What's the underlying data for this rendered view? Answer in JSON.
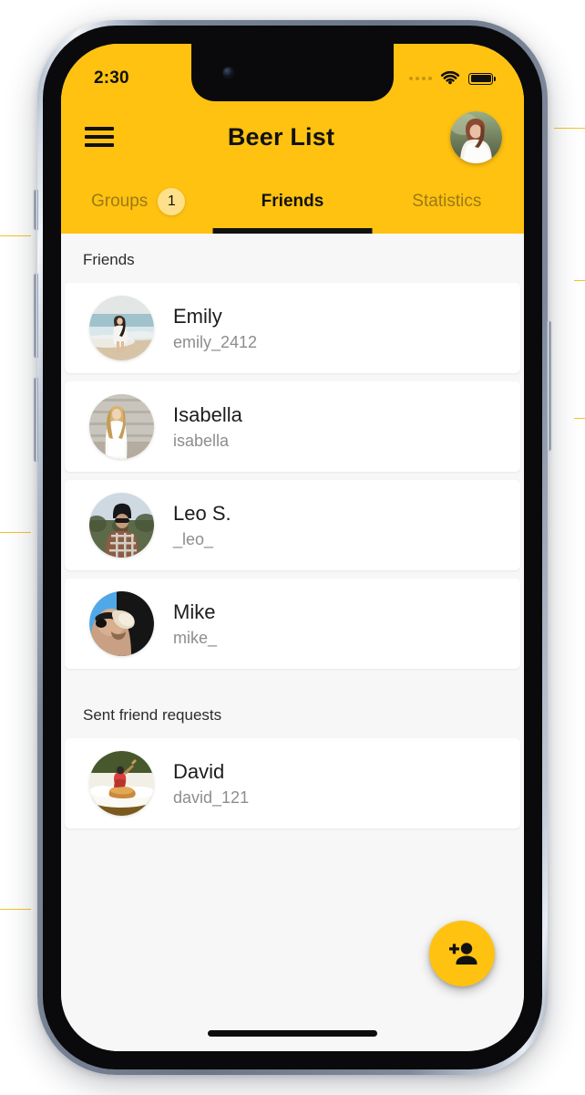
{
  "status_bar": {
    "time": "2:30",
    "signal_icon": "signal-dots-icon",
    "wifi_icon": "wifi-icon",
    "battery_icon": "battery-full-icon"
  },
  "app_bar": {
    "menu_icon": "hamburger-menu-icon",
    "title": "Beer List",
    "avatar_icon": "profile-avatar"
  },
  "tabs": [
    {
      "label": "Groups",
      "active": false,
      "badge": "1"
    },
    {
      "label": "Friends",
      "active": true,
      "badge": null
    },
    {
      "label": "Statistics",
      "active": false,
      "badge": null
    }
  ],
  "sections": [
    {
      "header": "Friends",
      "rows": [
        {
          "name": "Emily",
          "handle": "emily_2412",
          "avatar": "avatar-emily"
        },
        {
          "name": "Isabella",
          "handle": "isabella",
          "avatar": "avatar-isabella"
        },
        {
          "name": "Leo S.",
          "handle": "_leo_",
          "avatar": "avatar-leo"
        },
        {
          "name": "Mike",
          "handle": "mike_",
          "avatar": "avatar-mike"
        }
      ]
    },
    {
      "header": "Sent friend requests",
      "rows": [
        {
          "name": "David",
          "handle": "david_121",
          "avatar": "avatar-david"
        }
      ]
    }
  ],
  "fab": {
    "icon": "person-add-icon",
    "label": "Add friend"
  },
  "colors": {
    "accent_yellow": "#FFC211",
    "badge_yellow": "#FFE08A",
    "tab_inactive": "#9B7A13",
    "content_bg": "#F7F7F7",
    "card_bg": "#FFFFFF",
    "name_text": "#1C1C1C",
    "handle_text": "#8D8D8D"
  }
}
